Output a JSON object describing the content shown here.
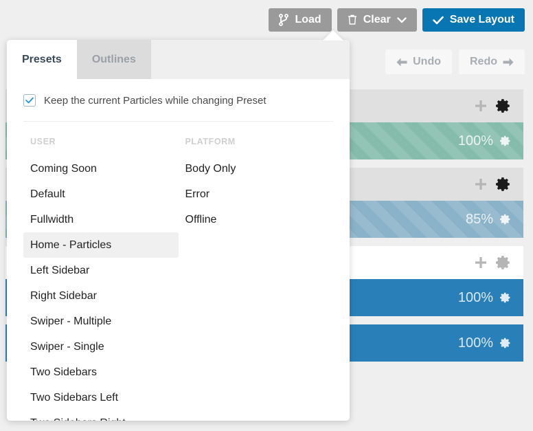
{
  "toolbar": {
    "load_label": "Load",
    "load_icon": "code-branch-icon",
    "clear_label": "Clear",
    "clear_icon": "trash-icon",
    "clear_caret_icon": "chevron-down-icon",
    "save_label": "Save Layout",
    "save_icon": "check-icon",
    "save_color": "#0876b3",
    "grey_color": "#9a9a9a"
  },
  "history": {
    "undo_label": "Undo",
    "undo_icon": "arrow-left-icon",
    "redo_label": "Redo",
    "redo_icon": "arrow-right-icon"
  },
  "sections": [
    {
      "head_style": "grey",
      "plus_icon": "plus-icon",
      "gear_icon": "gear-icon",
      "block": {
        "percent": "100%",
        "color": "#85bcac",
        "striped": true,
        "gear_icon": "gear-icon"
      }
    },
    {
      "head_style": "grey",
      "plus_icon": "plus-icon",
      "gear_icon": "gear-icon",
      "block": {
        "percent": "85%",
        "color": "#8ab2c9",
        "striped": true,
        "gear_icon": "gear-icon"
      }
    },
    {
      "head_style": "light",
      "plus_icon": "plus-icon",
      "gear_icon": "gear-icon",
      "block": {
        "percent": "100%",
        "color": "#2980b9",
        "striped": false,
        "gear_icon": "gear-icon"
      }
    },
    {
      "head_style": "none",
      "plus_icon": "",
      "gear_icon": "",
      "block": {
        "percent": "100%",
        "color": "#2980b9",
        "striped": false,
        "gear_icon": "gear-icon"
      }
    }
  ],
  "popup": {
    "tabs": [
      {
        "label": "Presets",
        "active": true
      },
      {
        "label": "Outlines",
        "active": false
      }
    ],
    "keep_checkbox": {
      "label": "Keep the current Particles while changing Preset",
      "checked": true,
      "icon": "check-icon"
    },
    "columns": [
      {
        "header": "USER",
        "items": [
          {
            "label": "Coming Soon",
            "selected": false
          },
          {
            "label": "Default",
            "selected": false
          },
          {
            "label": "Fullwidth",
            "selected": false
          },
          {
            "label": "Home - Particles",
            "selected": true
          },
          {
            "label": "Left Sidebar",
            "selected": false
          },
          {
            "label": "Right Sidebar",
            "selected": false
          },
          {
            "label": "Swiper - Multiple",
            "selected": false
          },
          {
            "label": "Swiper - Single",
            "selected": false
          },
          {
            "label": "Two Sidebars",
            "selected": false
          },
          {
            "label": "Two Sidebars Left",
            "selected": false
          },
          {
            "label": "Two Sidebars Right",
            "selected": false
          }
        ]
      },
      {
        "header": "PLATFORM",
        "items": [
          {
            "label": "Body Only",
            "selected": false
          },
          {
            "label": "Error",
            "selected": false
          },
          {
            "label": "Offline",
            "selected": false
          }
        ]
      }
    ]
  }
}
